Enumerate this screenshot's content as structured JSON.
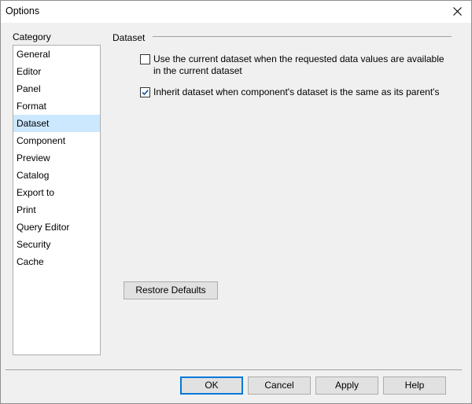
{
  "window": {
    "title": "Options"
  },
  "category": {
    "label": "Category",
    "items": [
      {
        "label": "General"
      },
      {
        "label": "Editor"
      },
      {
        "label": "Panel"
      },
      {
        "label": "Format"
      },
      {
        "label": "Dataset",
        "selected": true
      },
      {
        "label": "Component"
      },
      {
        "label": "Preview"
      },
      {
        "label": "Catalog"
      },
      {
        "label": "Export to"
      },
      {
        "label": "Print"
      },
      {
        "label": "Query Editor"
      },
      {
        "label": "Security"
      },
      {
        "label": "Cache"
      }
    ]
  },
  "section": {
    "title": "Dataset",
    "options": [
      {
        "label": "Use the current dataset when the requested data values are available in the current dataset",
        "checked": false
      },
      {
        "label": "Inherit dataset when component's dataset is the same as its parent's",
        "checked": true
      }
    ],
    "restore_label": "Restore Defaults"
  },
  "buttons": {
    "ok": "OK",
    "cancel": "Cancel",
    "apply": "Apply",
    "help": "Help"
  },
  "colors": {
    "selection": "#cce8ff",
    "accent": "#0078d7",
    "face": "#f0f0f0"
  }
}
